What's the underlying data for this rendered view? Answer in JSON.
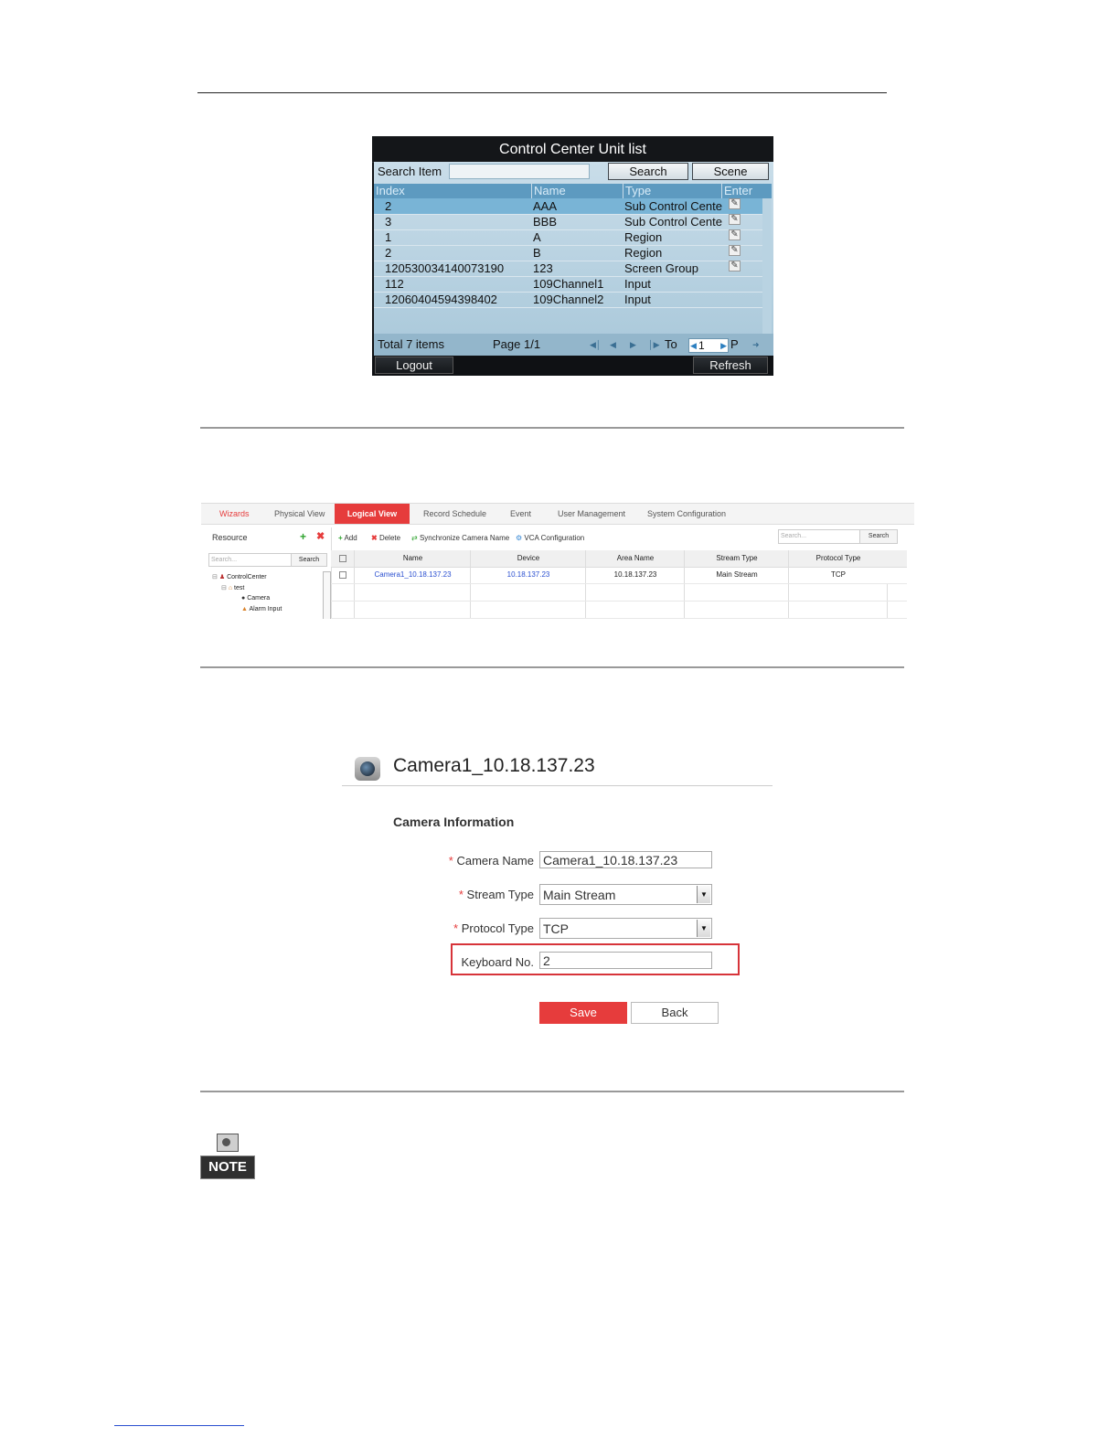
{
  "dvr": {
    "title": "Control Center Unit list",
    "search_label": "Search Item",
    "search_button": "Search",
    "scene_button": "Scene",
    "columns": [
      "Index",
      "Name",
      "Type",
      "Enter"
    ],
    "rows": [
      {
        "index": "2",
        "name": "AAA",
        "type": "Sub Control Cente",
        "enter": true
      },
      {
        "index": "3",
        "name": "BBB",
        "type": "Sub Control Cente",
        "enter": true
      },
      {
        "index": "1",
        "name": "A",
        "type": "Region",
        "enter": true
      },
      {
        "index": "2",
        "name": "B",
        "type": "Region",
        "enter": true
      },
      {
        "index": "120530034140073190",
        "name": "123",
        "type": "Screen Group",
        "enter": true
      },
      {
        "index": "112",
        "name": "109Channel1",
        "type": "Input",
        "enter": false
      },
      {
        "index": "12060404594398402",
        "name": "109Channel2",
        "type": "Input",
        "enter": false
      }
    ],
    "total": "Total 7 items",
    "page": "Page 1/1",
    "to_label": "To",
    "page_value": "1",
    "p_label": "P",
    "logout_button": "Logout",
    "refresh_button": "Refresh"
  },
  "web": {
    "tabs": [
      "Wizards",
      "Physical View",
      "Logical View",
      "Record Schedule",
      "Event",
      "User Management",
      "System Configuration"
    ],
    "active_tab": "Logical View",
    "sidebar_title": "Resource",
    "sidebar_search_placeholder": "Search...",
    "sidebar_search_button": "Search",
    "tree": [
      "ControlCenter",
      "test",
      "Camera",
      "Alarm Input"
    ],
    "toolbar": [
      "Add",
      "Delete",
      "Synchronize Camera Name",
      "VCA Configuration"
    ],
    "top_search_placeholder": "Search...",
    "top_search_button": "Search",
    "columns": [
      "Name",
      "Device",
      "Area Name",
      "Stream Type",
      "Protocol Type"
    ],
    "row": [
      "Camera1_10.18.137.23",
      "10.18.137.23",
      "10.18.137.23",
      "Main Stream",
      "TCP"
    ],
    "link_color": "#2a4fd0",
    "accent": "#e63c3c"
  },
  "form": {
    "title": "Camera1_10.18.137.23",
    "section": "Camera Information",
    "camera_name_label": "Camera Name",
    "camera_name_value": "Camera1_10.18.137.23",
    "stream_type_label": "Stream Type",
    "stream_type_value": "Main Stream",
    "protocol_type_label": "Protocol Type",
    "protocol_type_value": "TCP",
    "keyboard_label": "Keyboard No.",
    "keyboard_value": "2",
    "save_button": "Save",
    "back_button": "Back",
    "required_mark": "*"
  },
  "note_label": "NOTE"
}
